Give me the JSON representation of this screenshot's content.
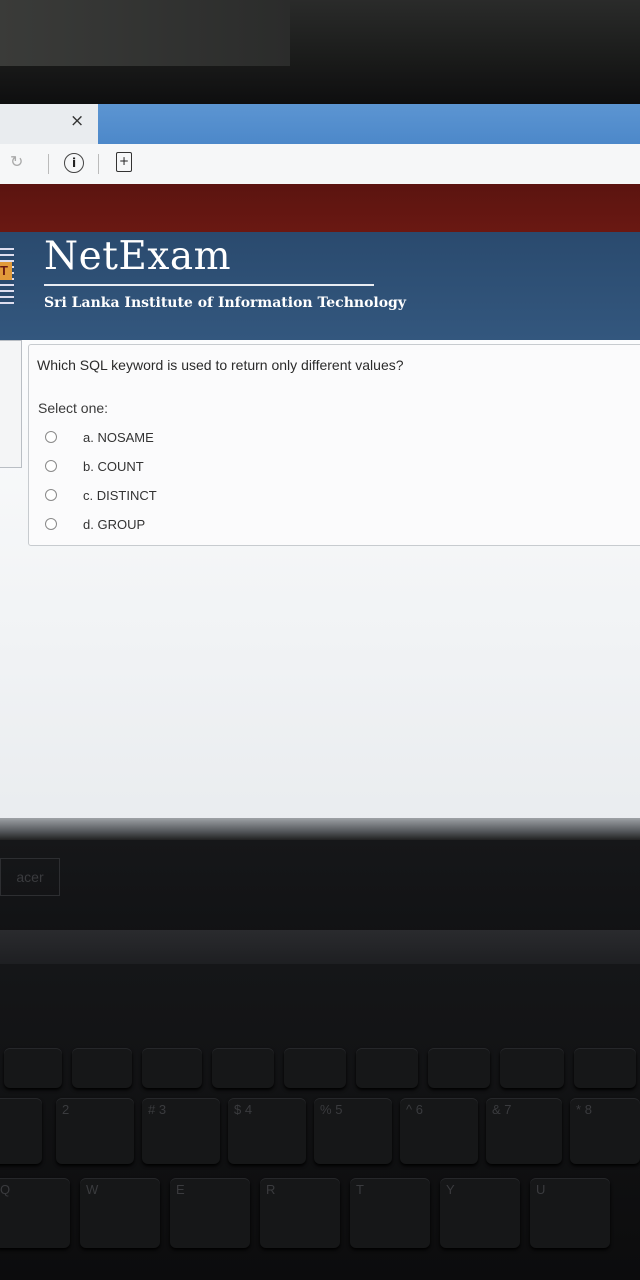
{
  "browser": {
    "close_glyph": "×",
    "reload_glyph": "↻",
    "info_glyph": "i",
    "page_glyph": "+"
  },
  "header": {
    "logo_letter": "T",
    "brand": "NetExam",
    "institute": "Sri Lanka Institute of Information Technology"
  },
  "question": {
    "text": "Which SQL keyword is used to return only different values?",
    "prompt": "Select one:",
    "options": [
      {
        "label": "a. NOSAME",
        "selected": false
      },
      {
        "label": "b. COUNT",
        "selected": false
      },
      {
        "label": "c. DISTINCT",
        "selected": false
      },
      {
        "label": "d. GROUP",
        "selected": false
      }
    ]
  },
  "laptop": {
    "chin_text": "acer",
    "keys": [
      "2",
      "#",
      "3",
      "$",
      "4",
      "%",
      "5",
      "^",
      "6",
      "&",
      "7",
      "*",
      "8",
      "Q",
      "W",
      "E",
      "R",
      "T",
      "Y",
      "U"
    ]
  },
  "colors": {
    "header_blue": "#2a4a6e",
    "header_accent": "#e5913a",
    "top_band_red": "#5b1410",
    "tab_blue": "#4a86c8"
  }
}
